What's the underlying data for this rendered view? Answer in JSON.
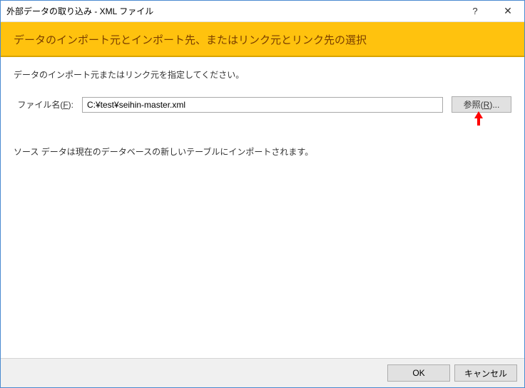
{
  "window": {
    "title": "外部データの取り込み - XML ファイル",
    "help_symbol": "?",
    "close_symbol": "✕"
  },
  "banner": {
    "title": "データのインポート元とインポート先、またはリンク元とリンク先の選択"
  },
  "body": {
    "instruction": "データのインポート元またはリンク元を指定してください。",
    "file_label_prefix": "ファイル名(",
    "file_label_key": "F",
    "file_label_suffix": "):",
    "file_value": "C:¥test¥seihin-master.xml",
    "browse_prefix": "参照(",
    "browse_key": "R",
    "browse_suffix": ")...",
    "note": "ソース データは現在のデータベースの新しいテーブルにインポートされます。"
  },
  "footer": {
    "ok": "OK",
    "cancel": "キャンセル"
  }
}
